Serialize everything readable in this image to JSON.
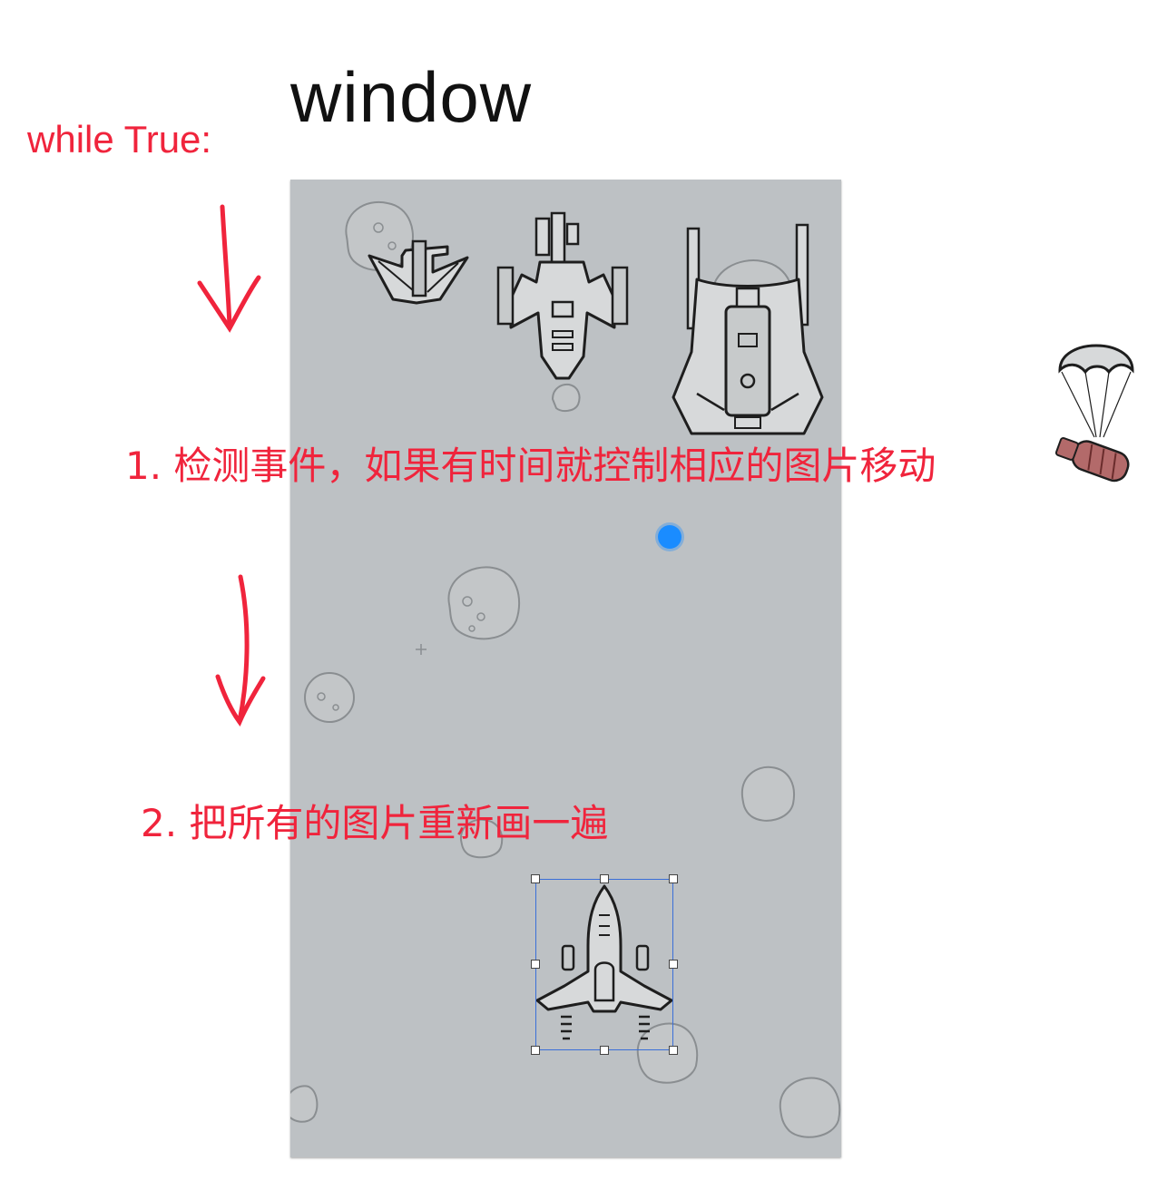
{
  "title": "window",
  "loop_label": "while True:",
  "steps": [
    "1. 检测事件，如果有时间就控制相应的图片移动",
    "2. 把所有的图片重新画一遍"
  ],
  "colors": {
    "accent": "#f0243c",
    "window_bg": "#bdc1c4",
    "selection": "#3a6fd8",
    "dot": "#1a8cff"
  },
  "icons": [
    "down-arrow-icon",
    "enemy-small-plane-icon",
    "enemy-medium-plane-icon",
    "enemy-large-plane-icon",
    "parachute-supply-icon",
    "hero-plane-icon",
    "bullet-dot-icon",
    "asteroid-icon"
  ]
}
